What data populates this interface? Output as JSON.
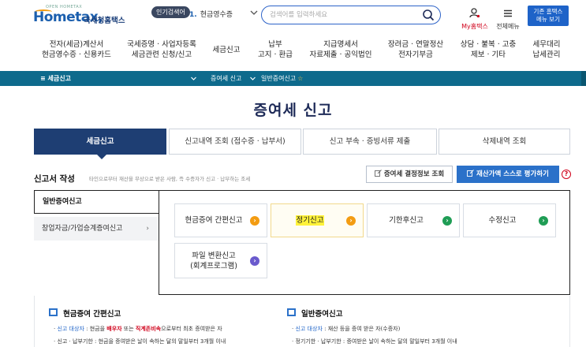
{
  "header": {
    "logo_tagline": "OPEN HOMETAX",
    "logo_brand": "Hometax,",
    "logo_org": "국세청홈택스",
    "popular_badge": "인기검색어",
    "popular_rank": "1.",
    "popular_term": "현금영수증",
    "search_placeholder": "검색어를 입력하세요",
    "my_hometax": "My홈택스",
    "all_menu": "전체메뉴",
    "legacy_line1": "기존 홈택스",
    "legacy_line2": "메뉴 보기"
  },
  "gnb": {
    "items": [
      {
        "line1": "전자(세금)계산서",
        "line2": "현금영수증 · 신용카드"
      },
      {
        "line1": "국세증명 · 사업자등록",
        "line2": "세금관련 신청/신고"
      },
      {
        "line1": "세금신고",
        "line2": ""
      },
      {
        "line1": "납부",
        "line2": "고지 · 환급"
      },
      {
        "line1": "지급명세서",
        "line2": "자료제출 · 공익법인"
      },
      {
        "line1": "장려금 · 연말정산",
        "line2": "전자기부금"
      },
      {
        "line1": "상담 · 불복 · 고충",
        "line2": "제보 · 기타"
      },
      {
        "line1": "세무대리",
        "line2": "납세관리"
      }
    ]
  },
  "breadcrumb": {
    "menu_label": "≡  세금신고",
    "level1": "증여세 신고",
    "level2": "일반증여신고",
    "star": "☆"
  },
  "page": {
    "title": "증여세 신고"
  },
  "tabs": [
    {
      "label": "세금신고",
      "active": true
    },
    {
      "label": "신고내역 조회 (접수증 · 납부서)",
      "active": false
    },
    {
      "label": "신고 부속 · 증빙서류 제출",
      "active": false
    },
    {
      "label": "삭제내역 조회",
      "active": false
    }
  ],
  "form": {
    "title": "신고서 작성",
    "description": "타인으로부터 재산을 무상으로 받은 사람, 즉 수증자가 신고 · 납부하는 조세",
    "decision_button": "증여세 결정정보 조회",
    "self_eval_button": "재산가액 스스로 평가하기",
    "help": "?"
  },
  "side_menu": {
    "general": "일반증여신고",
    "startup": "창업자금/가업승계증여신고",
    "startup_chevron": "›"
  },
  "options": [
    {
      "label": "현금증여 간편신고",
      "label2": "",
      "icon": "orange"
    },
    {
      "label": "정기신고",
      "label2": "",
      "icon": "orange",
      "highlighted": true
    },
    {
      "label": "기한후신고",
      "label2": "",
      "icon": "green"
    },
    {
      "label": "수정신고",
      "label2": "",
      "icon": "green"
    },
    {
      "label": "파일 변환신고",
      "label2": "(회계프로그램)",
      "icon": "purple"
    }
  ],
  "info": {
    "left_head": "현금증여 간편신고",
    "left_line1_key": "신고 대상자",
    "left_line1_a": " : 현금을 ",
    "left_line1_r1": "배우자",
    "left_line1_b": " 또는 ",
    "left_line1_r2": "직계존비속",
    "left_line1_c": "으로부터 최초 증여받은 자",
    "left_line2_key": "신고 · 납부기한",
    "left_line2_rest": " : 현금을 증여받은 날이 속하는 달의 말일부터 3개월 이내",
    "right_head": "일반증여신고",
    "right_line1_key": "신고 대상자",
    "right_line1_rest": " : 재산 등을 증여 받은 자(수증자)",
    "right_line2_key": "정기기한 · 납부기한",
    "right_line2_rest": " : 증여받은 날이 속하는 달의 말일부터 3개월 이내"
  },
  "colors": {
    "brand_blue": "#1b5fae",
    "breadcrumb_bar": "#0e6a8c",
    "active_tab": "#1e3e73",
    "primary_button": "#2b71c9",
    "accent_red": "#d0021b",
    "highlight_yellow": "#fff23a"
  }
}
